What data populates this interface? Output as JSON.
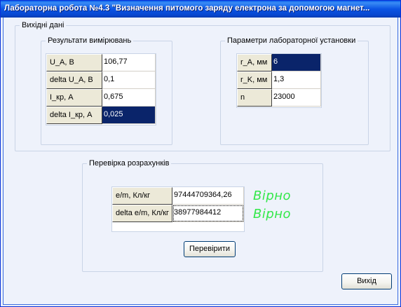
{
  "window": {
    "title": "Лабораторна робота №4.3 \"Визначення питомого заряду електрона за допомогою магнет..."
  },
  "input_group": {
    "label": "Вихідні дані",
    "measurements": {
      "label": "Результати вимірювань",
      "rows": [
        {
          "name": "U_A, В",
          "value": "106,77"
        },
        {
          "name": "delta U_A, В",
          "value": "0,1"
        },
        {
          "name": "I_кр, А",
          "value": "0,675"
        },
        {
          "name": "delta I_кр, А",
          "value": "0,025"
        }
      ]
    },
    "setup": {
      "label": "Параметри лабораторної установки",
      "rows": [
        {
          "name": "r_A, мм",
          "value": "6"
        },
        {
          "name": "r_K, мм",
          "value": "1,3"
        },
        {
          "name": "n",
          "value": "23000"
        }
      ]
    }
  },
  "check_group": {
    "label": "Перевірка розрахунків",
    "rows": [
      {
        "name": "e/m, Кл/кг",
        "value": "97444709364,26",
        "status": "Вірно"
      },
      {
        "name": "delta e/m, Кл/кг",
        "value": "38977984412",
        "status": "Вірно"
      }
    ],
    "check_button": "Перевірити"
  },
  "exit_button": "Вихід",
  "colors": {
    "titlebar": "#0b54e3",
    "selection": "#0a246a",
    "status_ok": "#33e84a"
  }
}
